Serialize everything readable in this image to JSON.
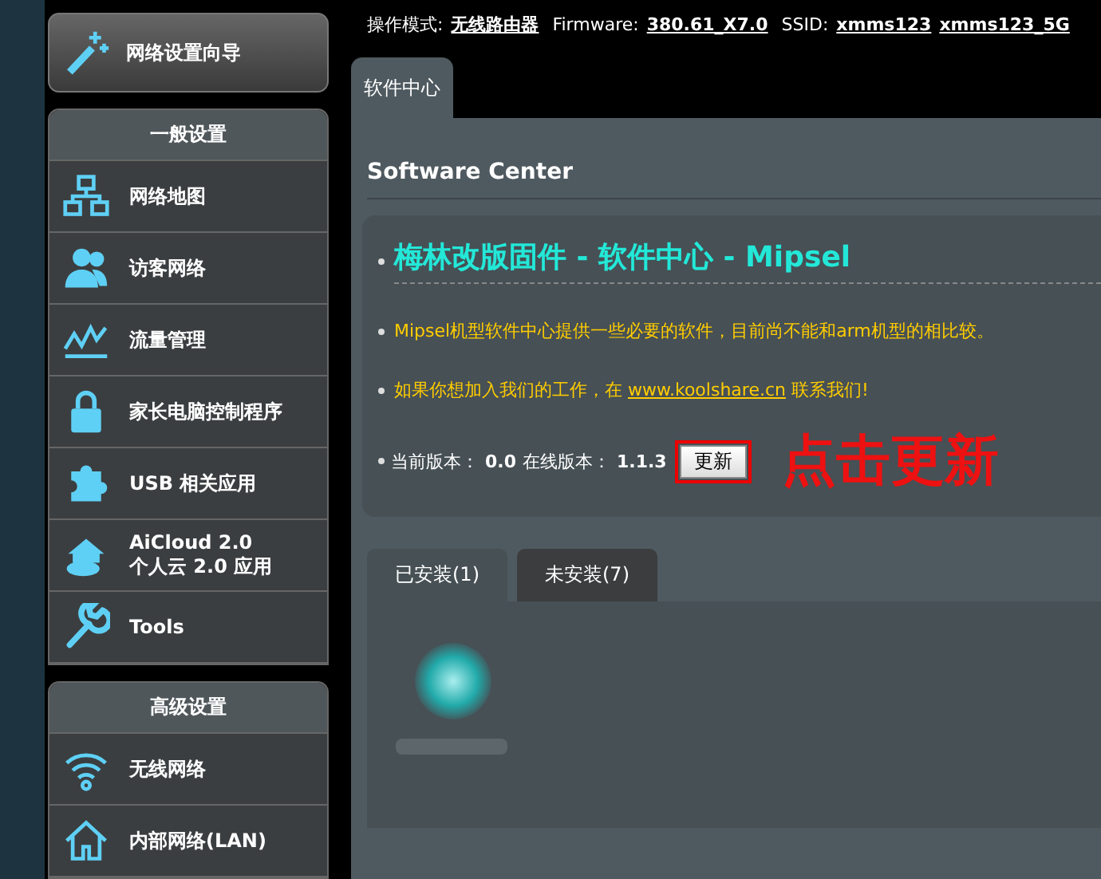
{
  "sidebar": {
    "wizard": {
      "label": "网络设置向导"
    },
    "sections": [
      {
        "title": "一般设置",
        "items": [
          {
            "label": "网络地图"
          },
          {
            "label": "访客网络"
          },
          {
            "label": "流量管理"
          },
          {
            "label": "家长电脑控制程序"
          },
          {
            "label": "USB 相关应用"
          },
          {
            "label": "AiCloud 2.0\n个人云 2.0 应用"
          },
          {
            "label": "Tools"
          }
        ]
      },
      {
        "title": "高级设置",
        "items": [
          {
            "label": "无线网络"
          },
          {
            "label": "内部网络(LAN)"
          }
        ]
      }
    ]
  },
  "status_bar": {
    "mode_label": "操作模式:",
    "mode": "无线路由器",
    "firmware_label": "Firmware:",
    "firmware": "380.61_X7.0",
    "ssid_label": "SSID:",
    "ssids": [
      "xmms123",
      "xmms123_5G"
    ]
  },
  "tabs": [
    {
      "label": "软件中心",
      "selected": true
    }
  ],
  "page": {
    "title": "Software Center",
    "heading": "梅林改版固件 - 软件中心 - Mipsel",
    "notice": "Mipsel机型软件中心提供一些必要的软件，目前尚不能和arm机型的相比较。",
    "join_before": "如果你想加入我们的工作，在",
    "join_link": "www.koolshare.cn",
    "join_after": "联系我们!",
    "current_label": "当前版本：",
    "current": "0.0",
    "online_label": "在线版本：",
    "online": "1.1.3",
    "update_button": "更新",
    "annotation": "点击更新"
  },
  "install_tabs": [
    {
      "label": "已安装(1)",
      "selected": true
    },
    {
      "label": "未安装(7)",
      "selected": false
    }
  ]
}
